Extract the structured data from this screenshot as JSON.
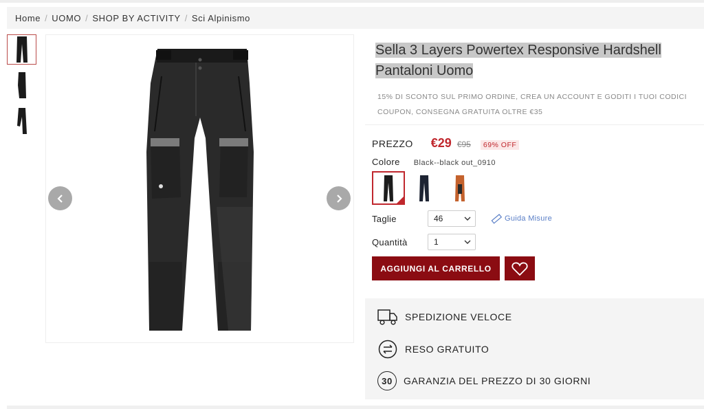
{
  "breadcrumb": {
    "items": [
      "Home",
      "UOMO",
      "SHOP BY ACTIVITY",
      "Sci Alpinismo"
    ]
  },
  "product": {
    "title_line1": "Sella 3 Layers Powertex Responsive Hardshell",
    "title_line2": "Pantaloni Uomo",
    "promo_line1": "15% DI SCONTO SUL PRIMO ORDINE, CREA UN ACCOUNT E GODITI I TUOI CODICI",
    "promo_line2": "COUPON, CONSEGNA GRATUITA OLTRE €35"
  },
  "price": {
    "label": "PREZZO",
    "current": "€29",
    "original": "€95",
    "discount": "69% OFF"
  },
  "color": {
    "label": "Colore",
    "selected": "Black--black out_0910",
    "swatches": [
      {
        "name": "black",
        "color": "#1c1c1c"
      },
      {
        "name": "navy",
        "color": "#1d2433"
      },
      {
        "name": "orange",
        "color": "#c4622d"
      }
    ]
  },
  "size": {
    "label": "Taglie",
    "selected": "46",
    "guide": "Guida Misure"
  },
  "quantity": {
    "label": "Quantità",
    "selected": "1"
  },
  "actions": {
    "add_to_cart": "AGGIUNGI AL CARRELLO"
  },
  "benefits": {
    "shipping": "SPEDIZIONE VELOCE",
    "returns": "RESO GRATUITO",
    "guarantee": "GARANZIA DEL PREZZO DI 30 GIORNI",
    "guarantee_icon_text": "30"
  },
  "colors": {
    "accent": "#8b0c12",
    "price_red": "#c0272d",
    "link_blue": "#5a7fc7"
  }
}
